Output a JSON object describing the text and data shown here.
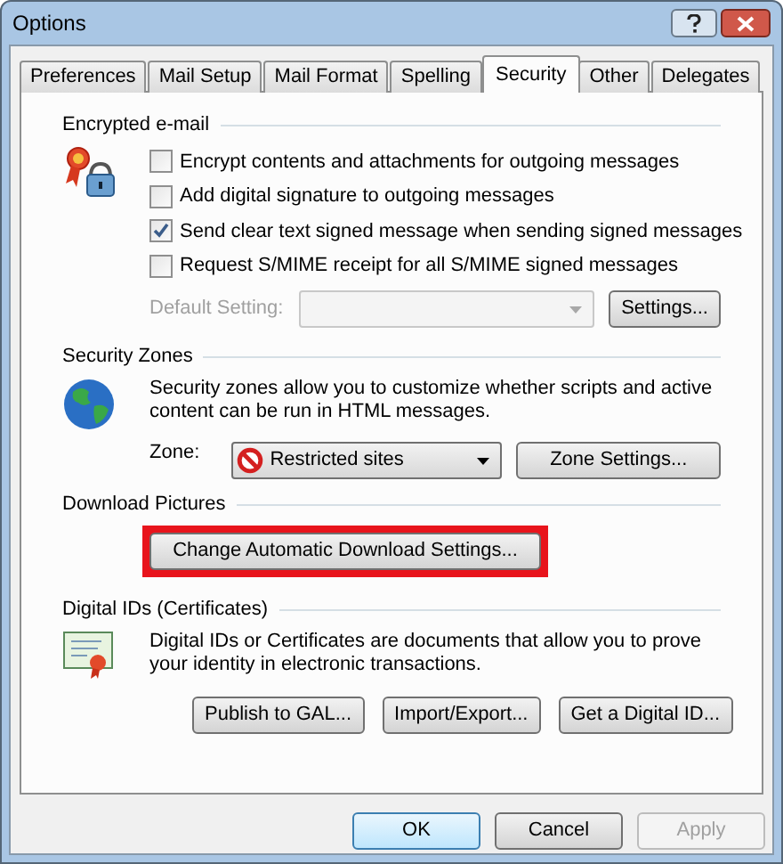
{
  "window": {
    "title": "Options"
  },
  "tabs": [
    {
      "label": "Preferences",
      "selected": false
    },
    {
      "label": "Mail Setup",
      "selected": false
    },
    {
      "label": "Mail Format",
      "selected": false
    },
    {
      "label": "Spelling",
      "selected": false
    },
    {
      "label": "Security",
      "selected": true
    },
    {
      "label": "Other",
      "selected": false
    },
    {
      "label": "Delegates",
      "selected": false
    }
  ],
  "encrypted_email": {
    "heading": "Encrypted e-mail",
    "options": [
      {
        "label": "Encrypt contents and attachments for outgoing messages",
        "checked": false
      },
      {
        "label": "Add digital signature to outgoing messages",
        "checked": false
      },
      {
        "label": "Send clear text signed message when sending signed messages",
        "checked": true
      },
      {
        "label": "Request S/MIME receipt for all S/MIME signed messages",
        "checked": false
      }
    ],
    "default_setting": {
      "label": "Default Setting:",
      "disabled": true
    },
    "settings_button": "Settings..."
  },
  "security_zones": {
    "heading": "Security Zones",
    "description": "Security zones allow you to customize whether scripts and active content can be run in HTML messages.",
    "zone_label": "Zone:",
    "zone_value": "Restricted sites",
    "zone_settings_button": "Zone Settings..."
  },
  "download_pictures": {
    "heading": "Download Pictures",
    "button": {
      "label": "Change Automatic Download Settings...",
      "highlighted": true
    }
  },
  "digital_ids": {
    "heading": "Digital IDs (Certificates)",
    "description": "Digital IDs or Certificates are documents that allow you to prove your identity in electronic transactions.",
    "buttons": [
      "Publish to GAL...",
      "Import/Export...",
      "Get a Digital ID..."
    ]
  },
  "footer_buttons": [
    {
      "label": "OK",
      "default": true,
      "disabled": false
    },
    {
      "label": "Cancel",
      "default": false,
      "disabled": false
    },
    {
      "label": "Apply",
      "default": false,
      "disabled": true
    }
  ]
}
